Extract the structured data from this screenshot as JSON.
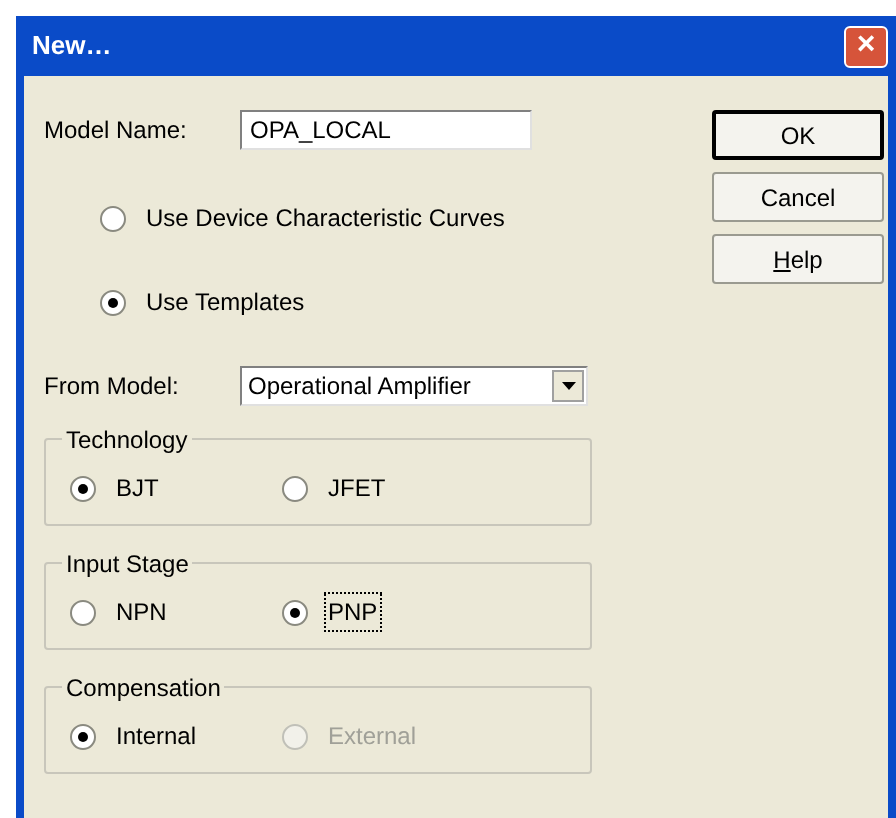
{
  "window": {
    "title": "New…",
    "close": "×"
  },
  "model_name": {
    "label": "Model Name:",
    "value": "OPA_LOCAL"
  },
  "buttons": [
    {
      "label": "OK",
      "default": true
    },
    {
      "label": "Cancel",
      "default": false
    },
    {
      "label": "Help",
      "default": false,
      "underline_first": true
    }
  ],
  "source": [
    {
      "label": "Use Device Characteristic Curves",
      "selected": false
    },
    {
      "label": "Use Templates",
      "selected": true
    }
  ],
  "from_model": {
    "label": "From Model:",
    "value": "Operational Amplifier"
  },
  "groups": [
    {
      "title": "Technology",
      "options": [
        {
          "label": "BJT",
          "selected": true,
          "disabled": false,
          "focused": false
        },
        {
          "label": "JFET",
          "selected": false,
          "disabled": false,
          "focused": false
        }
      ]
    },
    {
      "title": "Input Stage",
      "options": [
        {
          "label": "NPN",
          "selected": false,
          "disabled": false,
          "focused": false
        },
        {
          "label": "PNP",
          "selected": true,
          "disabled": false,
          "focused": true
        }
      ]
    },
    {
      "title": "Compensation",
      "options": [
        {
          "label": "Internal",
          "selected": true,
          "disabled": false,
          "focused": false
        },
        {
          "label": "External",
          "selected": false,
          "disabled": true,
          "focused": false
        }
      ]
    }
  ]
}
